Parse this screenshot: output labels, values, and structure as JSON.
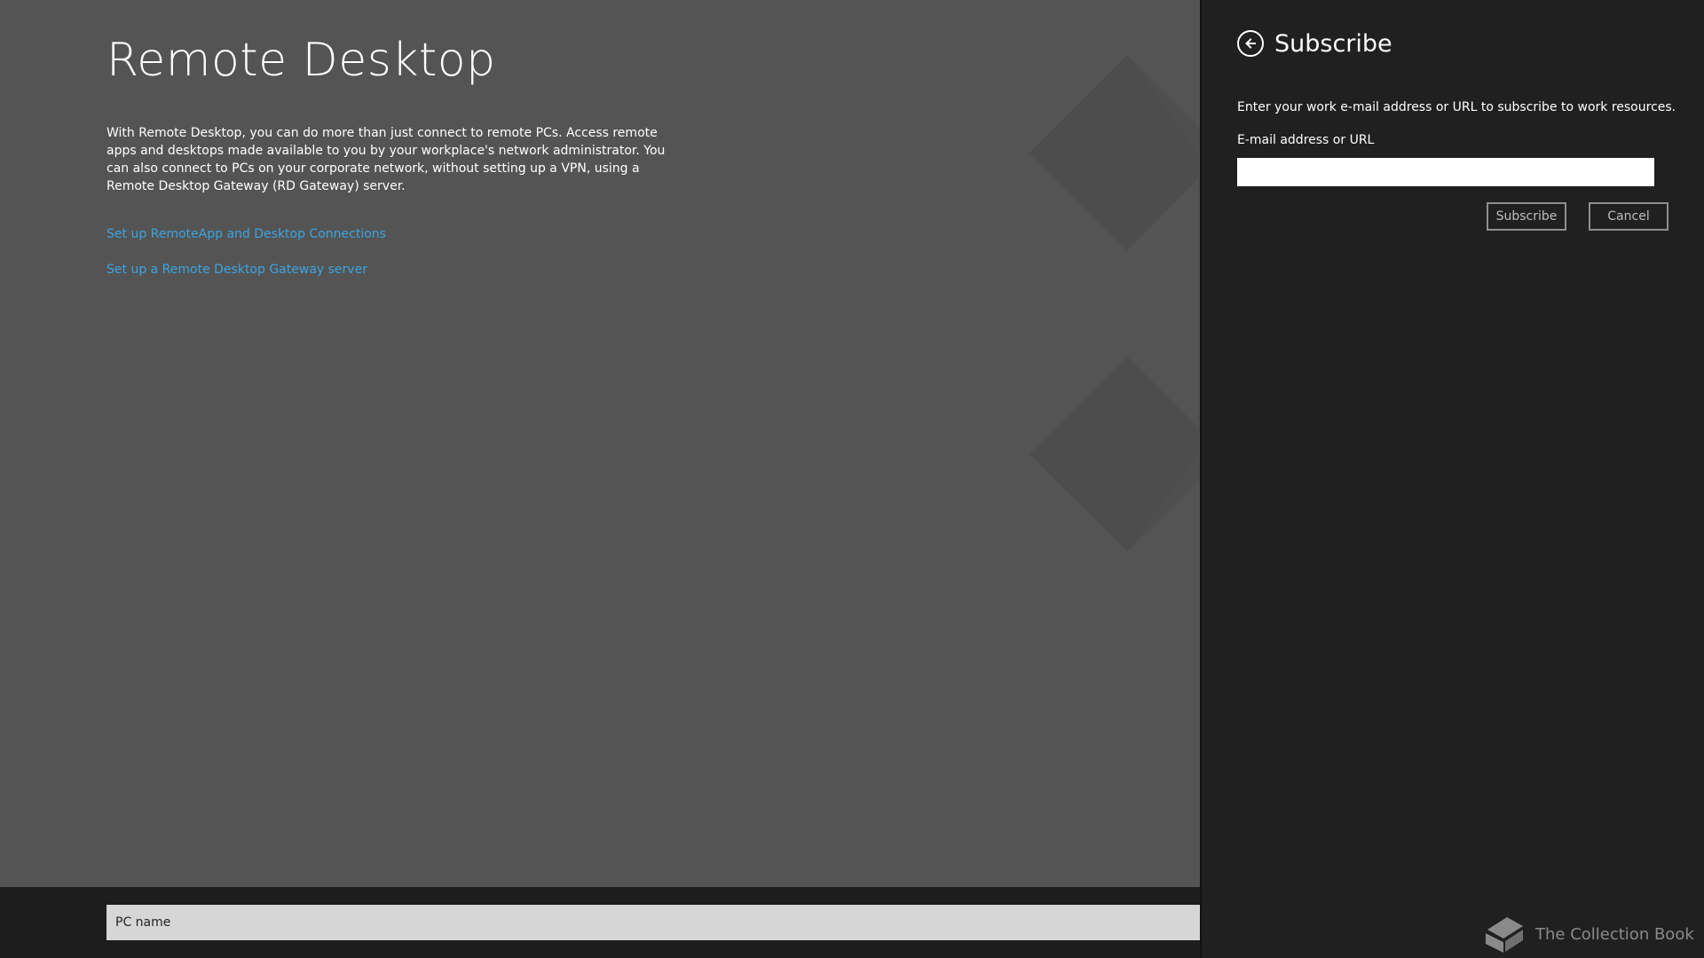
{
  "app": {
    "title": "Remote Desktop",
    "description": "With Remote Desktop, you can do more than just connect to remote PCs. Access remote apps and desktops made available to you by your workplace's network administrator. You can also connect to PCs on your corporate network, without setting up a VPN, using a Remote Desktop Gateway (RD Gateway) server.",
    "links": [
      {
        "label": "Set up RemoteApp and Desktop Connections"
      },
      {
        "label": "Set up a Remote Desktop Gateway server"
      }
    ],
    "pc_name": {
      "placeholder": "PC name",
      "value": ""
    }
  },
  "flyout": {
    "title": "Subscribe",
    "instructions": "Enter your work e-mail address or URL to subscribe to work resources.",
    "field_label": "E-mail address or URL",
    "field_value": "",
    "subscribe_label": "Subscribe",
    "cancel_label": "Cancel"
  },
  "watermark": {
    "text": "The Collection Book",
    "icon": "book-icon"
  },
  "icons": {
    "back": "back-arrow-icon",
    "background": "remote-desktop-logo-icon"
  },
  "colors": {
    "app_background": "#545454",
    "flyout_background": "#202020",
    "link": "#3ea4e0",
    "bottom_bar": "#1d1d1d",
    "input_bar": "#d6d6d6"
  }
}
